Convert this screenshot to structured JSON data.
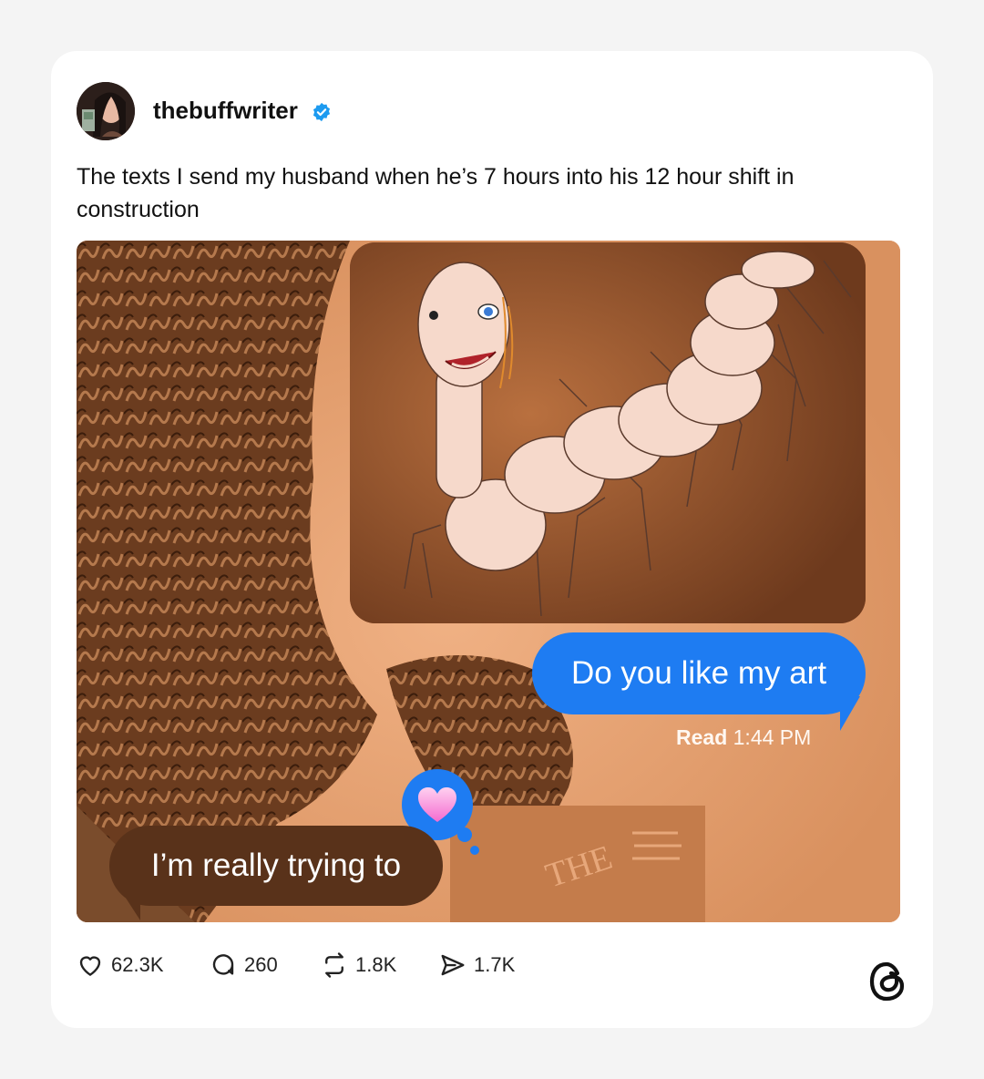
{
  "post": {
    "username": "thebuffwriter",
    "verified": true,
    "caption": "The texts I send my husband when he’s 7 hours into his 12 hour shift in construction"
  },
  "media": {
    "sent_message": "Do you like my art",
    "read_label": "Read",
    "read_time": "1:44 PM",
    "received_message": "I’m really trying to",
    "reaction": "heart",
    "book_text": "THE"
  },
  "stats": {
    "likes": "62.3K",
    "replies": "260",
    "reposts": "1.8K",
    "shares": "1.7K"
  },
  "colors": {
    "imessage_blue": "#1e7cf2",
    "received_bubble": "#59321a",
    "photo_tint": "#e9a77c",
    "verified_badge": "#1d9bf0"
  },
  "icons": [
    "heart-icon",
    "reply-icon",
    "repost-icon",
    "share-icon",
    "threads-logo-icon",
    "verified-badge-icon"
  ]
}
